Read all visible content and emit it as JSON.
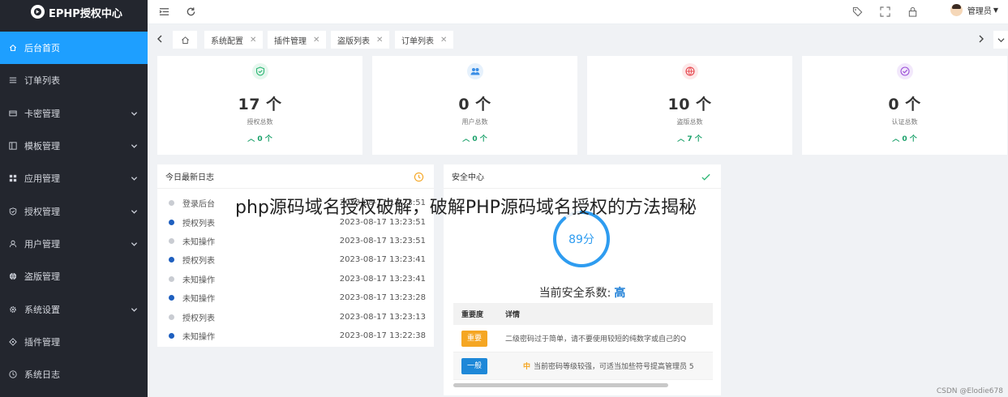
{
  "app": {
    "title": "EPHP授权中心"
  },
  "sidebar": {
    "items": [
      {
        "label": "后台首页",
        "icon": "home-icon",
        "active": true,
        "expandable": false
      },
      {
        "label": "订单列表",
        "icon": "list-icon",
        "active": false,
        "expandable": false
      },
      {
        "label": "卡密管理",
        "icon": "card-icon",
        "active": false,
        "expandable": true
      },
      {
        "label": "模板管理",
        "icon": "template-icon",
        "active": false,
        "expandable": true
      },
      {
        "label": "应用管理",
        "icon": "apps-icon",
        "active": false,
        "expandable": true
      },
      {
        "label": "授权管理",
        "icon": "shield-icon",
        "active": false,
        "expandable": true
      },
      {
        "label": "用户管理",
        "icon": "user-icon",
        "active": false,
        "expandable": true
      },
      {
        "label": "盗版管理",
        "icon": "globe-icon",
        "active": false,
        "expandable": false
      },
      {
        "label": "系统设置",
        "icon": "gear-icon",
        "active": false,
        "expandable": true
      },
      {
        "label": "插件管理",
        "icon": "plugin-icon",
        "active": false,
        "expandable": false
      },
      {
        "label": "系统日志",
        "icon": "clock-icon",
        "active": false,
        "expandable": false
      }
    ]
  },
  "header": {
    "user_label": "管理员",
    "icons": [
      "menu-toggle-icon",
      "refresh-icon",
      "tag-icon",
      "fullscreen-icon",
      "lock-icon"
    ]
  },
  "tabs": {
    "items": [
      {
        "label": "系统配置"
      },
      {
        "label": "插件管理"
      },
      {
        "label": "盗版列表"
      },
      {
        "label": "订单列表"
      }
    ]
  },
  "stats": [
    {
      "value": "17 个",
      "label": "授权总数",
      "change": "0 个",
      "icon": "shield-check-icon",
      "color": "#2bb673",
      "bg": "#e6f7ee"
    },
    {
      "value": "0 个",
      "label": "用户总数",
      "change": "0 个",
      "icon": "users-icon",
      "color": "#3a8ee6",
      "bg": "#e6f1fc"
    },
    {
      "value": "10 个",
      "label": "盗版总数",
      "change": "7 个",
      "icon": "globe-icon",
      "color": "#e6484f",
      "bg": "#fde8e9"
    },
    {
      "value": "0 个",
      "label": "认证总数",
      "change": "0 个",
      "icon": "check-circle-icon",
      "color": "#9b4fd8",
      "bg": "#f2e8fb"
    }
  ],
  "log": {
    "title": "今日最新日志",
    "rows": [
      {
        "action": "登录后台",
        "time": "2023-08-17 13:23:51",
        "dot": "gray"
      },
      {
        "action": "授权列表",
        "time": "2023-08-17 13:23:51",
        "dot": "blue"
      },
      {
        "action": "未知操作",
        "time": "2023-08-17 13:23:51",
        "dot": "gray"
      },
      {
        "action": "授权列表",
        "time": "2023-08-17 13:23:41",
        "dot": "blue"
      },
      {
        "action": "未知操作",
        "time": "2023-08-17 13:23:41",
        "dot": "gray"
      },
      {
        "action": "未知操作",
        "time": "2023-08-17 13:23:28",
        "dot": "blue"
      },
      {
        "action": "授权列表",
        "time": "2023-08-17 13:23:13",
        "dot": "gray"
      },
      {
        "action": "未知操作",
        "time": "2023-08-17 13:22:38",
        "dot": "blue"
      }
    ]
  },
  "security": {
    "title": "安全中心",
    "score": "89分",
    "score_value": 89,
    "level_prefix": "当前安全系数:",
    "level": "高",
    "headers": {
      "importance": "重要度",
      "detail": "详情"
    },
    "rows": [
      {
        "badge": "重要",
        "badge_color": "orange",
        "detail_prefix": "",
        "detail": "二级密码过于简单，请不要使用较短的纯数字或自己的Q"
      },
      {
        "badge": "一般",
        "badge_color": "blue",
        "detail_prefix": "中",
        "detail": "当前密码等级较强，可适当加些符号提高管理员 5"
      }
    ]
  },
  "overlay_title": "php源码域名授权破解，破解PHP源码域名授权的方法揭秘",
  "watermark": "CSDN @Elodie678"
}
